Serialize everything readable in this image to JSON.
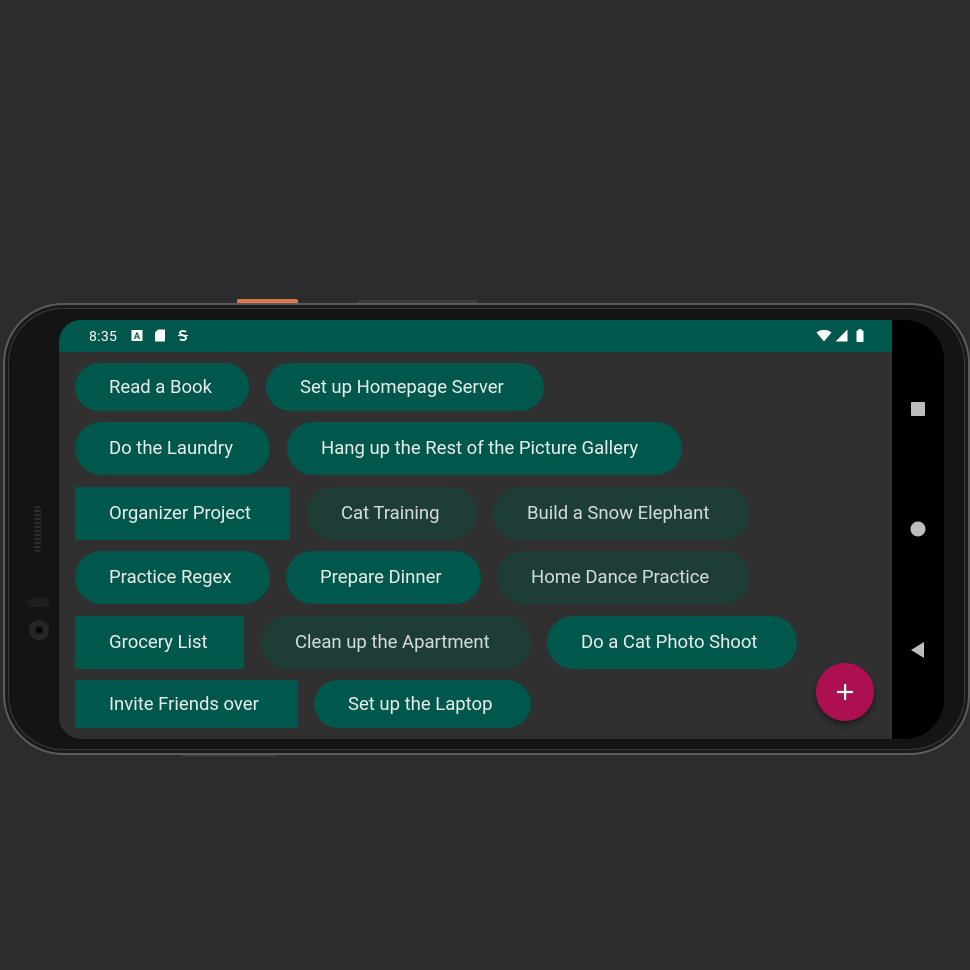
{
  "status_bar": {
    "time": "8:35",
    "left_icons": [
      "a-notification-icon",
      "sd-card-icon",
      "sync-icon"
    ],
    "right_icons": [
      "wifi-icon",
      "signal-icon",
      "battery-icon"
    ]
  },
  "chips": [
    {
      "label": "Read a Book",
      "style": "teal"
    },
    {
      "label": "Set up Homepage Server",
      "style": "teal"
    },
    {
      "label": "Do the Laundry",
      "style": "teal"
    },
    {
      "label": "Hang up the Rest of the Picture Gallery",
      "style": "teal"
    },
    {
      "label": "Organizer Project",
      "style": "teal-square"
    },
    {
      "label": "Cat Training",
      "style": "dark"
    },
    {
      "label": "Build a Snow Elephant",
      "style": "dark"
    },
    {
      "label": "Practice Regex",
      "style": "teal"
    },
    {
      "label": "Prepare Dinner",
      "style": "teal"
    },
    {
      "label": "Home Dance Practice",
      "style": "dark"
    },
    {
      "label": "Grocery List",
      "style": "teal-square"
    },
    {
      "label": "Clean up the Apartment",
      "style": "dark"
    },
    {
      "label": "Do a Cat Photo Shoot",
      "style": "teal"
    },
    {
      "label": "Invite Friends over",
      "style": "teal-square"
    },
    {
      "label": "Set up the Laptop",
      "style": "teal"
    }
  ],
  "fab": {
    "icon": "plus-icon",
    "color": "#ad1050"
  },
  "nav_bar": {
    "buttons": [
      "recents-icon",
      "home-icon",
      "back-icon"
    ]
  },
  "colors": {
    "primary": "#00574b",
    "chip_dark": "#1f3d37",
    "background": "#303030",
    "accent": "#ad1050"
  }
}
